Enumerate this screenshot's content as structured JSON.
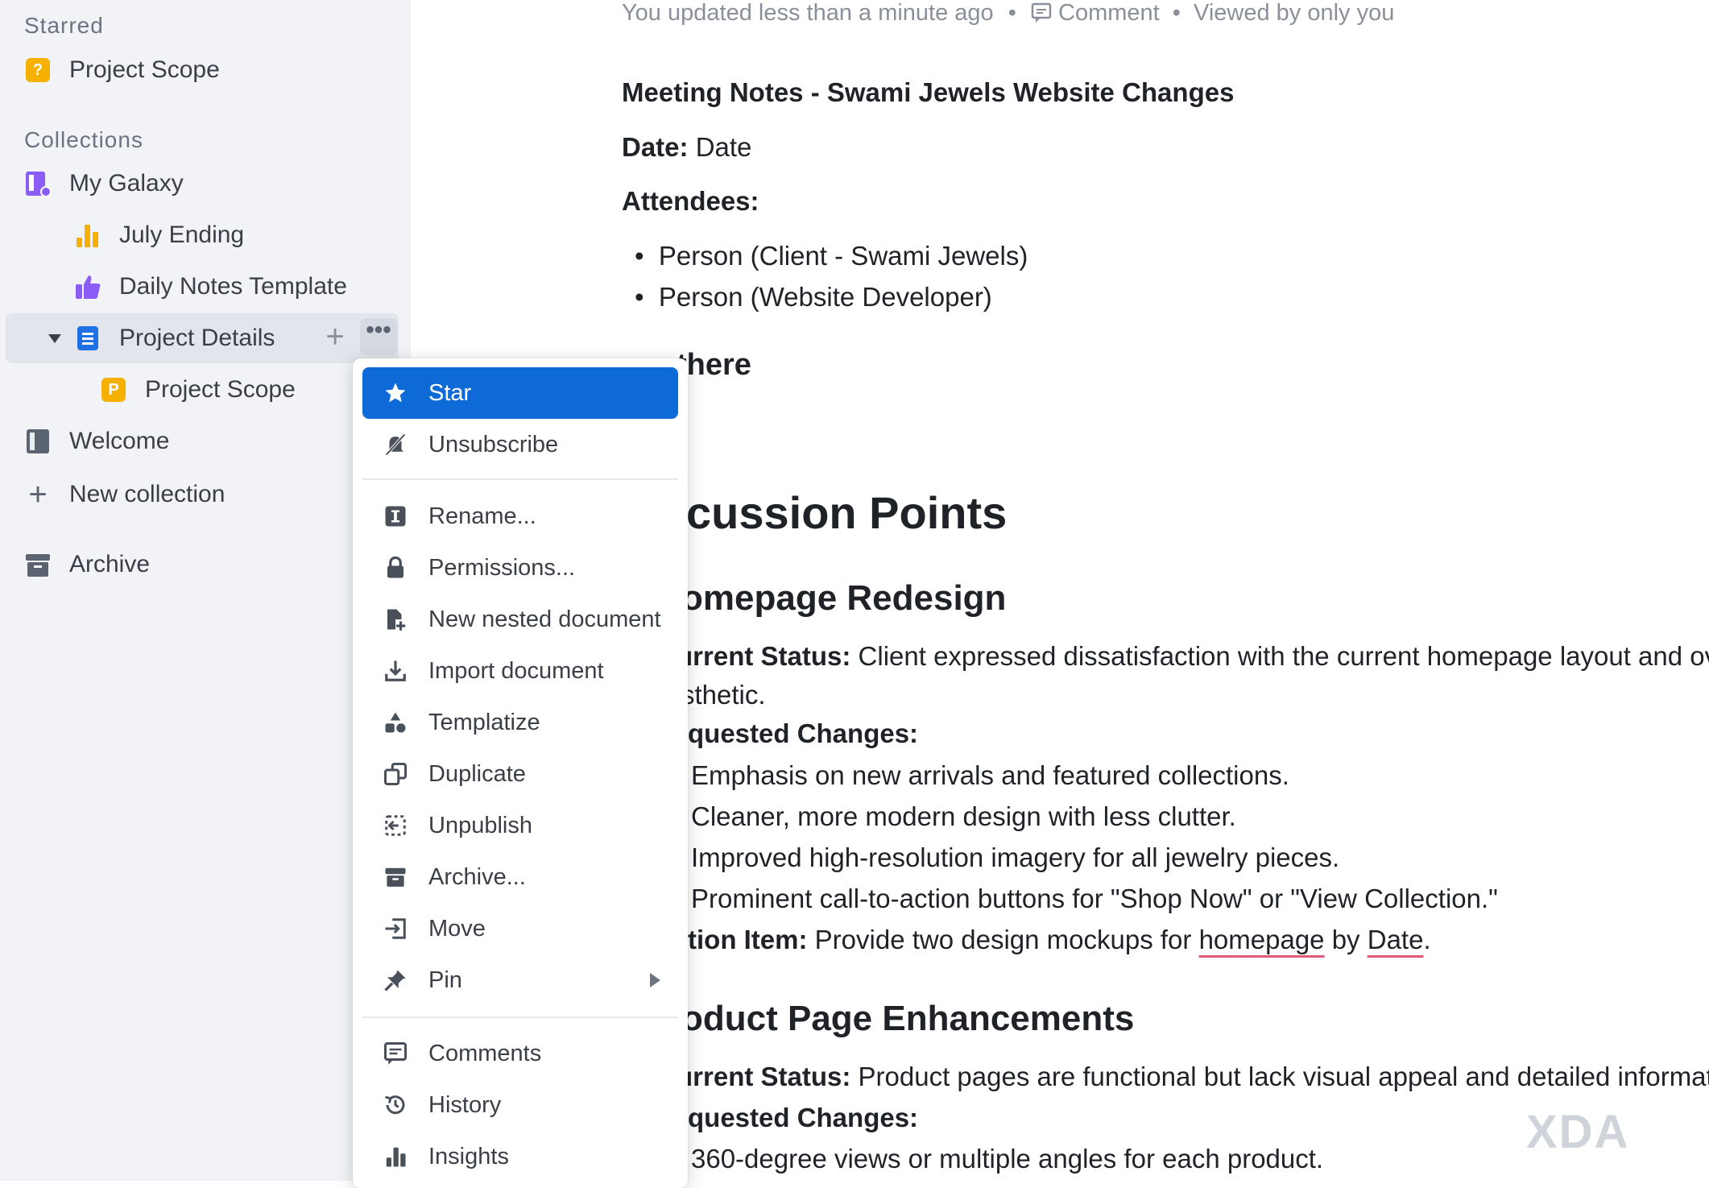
{
  "sidebar": {
    "starred_heading": "Starred",
    "starred_item": "Project Scope",
    "collections_heading": "Collections",
    "items": [
      {
        "label": "My Galaxy"
      },
      {
        "label": "July Ending"
      },
      {
        "label": "Daily Notes Template"
      },
      {
        "label": "Project Details"
      },
      {
        "label": "Project Scope"
      },
      {
        "label": "Welcome"
      }
    ],
    "new_collection": "New collection",
    "archive": "Archive",
    "badges": {
      "starred": "?",
      "nested": "P"
    }
  },
  "header": {
    "updated": "You updated less than a minute ago",
    "comment": "Comment",
    "viewed": "Viewed by only you"
  },
  "doc": {
    "title": "Meeting Notes - Swami Jewels Website Changes",
    "date_label": "Date:",
    "date_value": "Date",
    "attendees_label": "Attendees:",
    "attendees": [
      "Person (Client - Swami Jewels)",
      "Person (Website Developer)"
    ],
    "partial_heading": "there",
    "section_heading": "cussion Points",
    "sub1": "omepage Redesign",
    "s1_status_label": "urrent Status:",
    "s1_status_text": "Client expressed dissatisfaction with the current homepage layout and ove",
    "s1_status_cont": "sthetic.",
    "s1_changes_label": "quested Changes:",
    "s1_changes": [
      "Emphasis on new arrivals and featured collections.",
      "Cleaner, more modern design with less clutter.",
      "Improved high-resolution imagery for all jewelry pieces.",
      "Prominent call-to-action buttons for \"Shop Now\" or \"View Collection.\""
    ],
    "s1_action_label": "tion Item:",
    "s1_action_text": "Provide two design mockups for",
    "s1_action_link1": "homepage",
    "s1_action_by": "by",
    "s1_action_link2": "Date",
    "s1_action_end": ".",
    "sub2": "oduct Page Enhancements",
    "s2_status_label": "urrent Status:",
    "s2_status_text": "Product pages are functional but lack visual appeal and detailed informatio",
    "s2_changes_label": "quested Changes:",
    "s2_change1": "360-degree views or multiple angles for each product."
  },
  "menu": {
    "items": [
      {
        "label": "Star",
        "icon": "star-icon"
      },
      {
        "label": "Unsubscribe",
        "icon": "bell-off-icon"
      },
      {
        "label": "Rename...",
        "icon": "rename-icon"
      },
      {
        "label": "Permissions...",
        "icon": "lock-icon"
      },
      {
        "label": "New nested document",
        "icon": "new-doc-icon"
      },
      {
        "label": "Import document",
        "icon": "import-icon"
      },
      {
        "label": "Templatize",
        "icon": "shapes-icon"
      },
      {
        "label": "Duplicate",
        "icon": "duplicate-icon"
      },
      {
        "label": "Unpublish",
        "icon": "unpublish-icon"
      },
      {
        "label": "Archive...",
        "icon": "archive-icon"
      },
      {
        "label": "Move",
        "icon": "move-icon"
      },
      {
        "label": "Pin",
        "icon": "pin-icon"
      },
      {
        "label": "Comments",
        "icon": "comment-icon"
      },
      {
        "label": "History",
        "icon": "history-icon"
      },
      {
        "label": "Insights",
        "icon": "insights-icon"
      }
    ]
  },
  "watermark": "XDA",
  "colors": {
    "accent": "#0e6ad7",
    "sidebar_bg": "#f1f3f6",
    "badge_yellow": "#f5b000",
    "purple": "#8b5cf6",
    "doc_blue": "#1f6fe5"
  }
}
